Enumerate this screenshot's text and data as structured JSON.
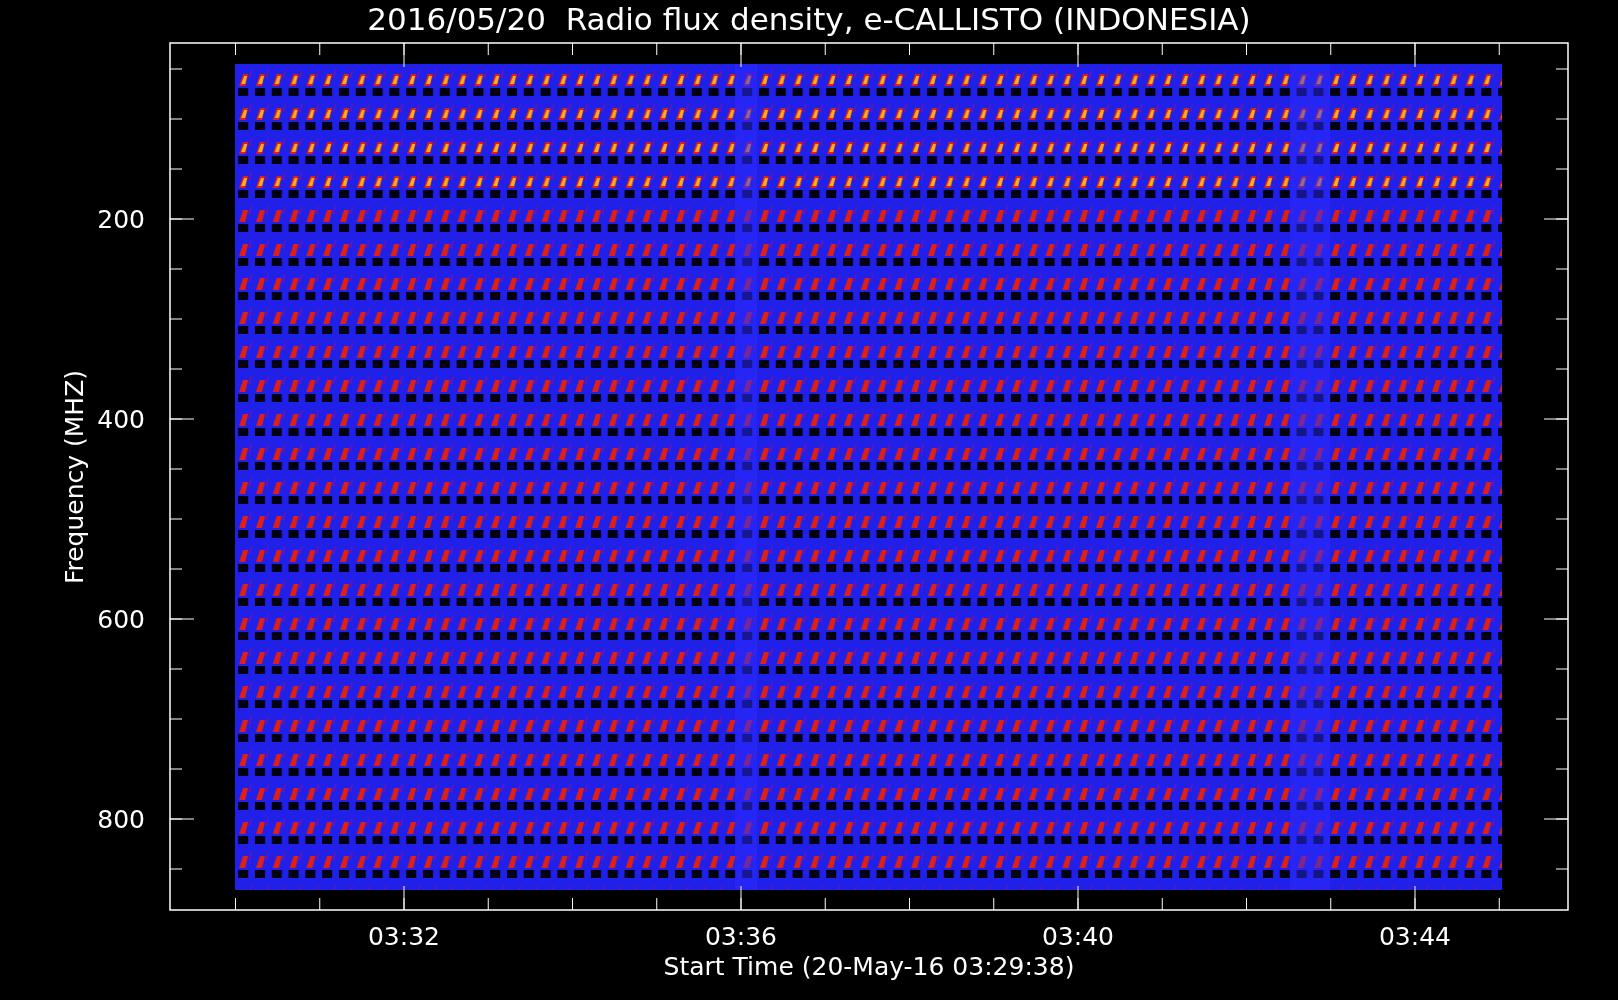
{
  "title": "2016/05/20  Radio flux density, e-CALLISTO (INDONESIA)",
  "y_axis": {
    "label": "Frequency (MHZ)",
    "ticks": [
      "200",
      "400",
      "600",
      "800"
    ]
  },
  "x_axis": {
    "label": "Start Time (20-May-16 03:29:38)",
    "ticks": [
      "03:32",
      "03:36",
      "03:40",
      "03:44"
    ]
  }
}
